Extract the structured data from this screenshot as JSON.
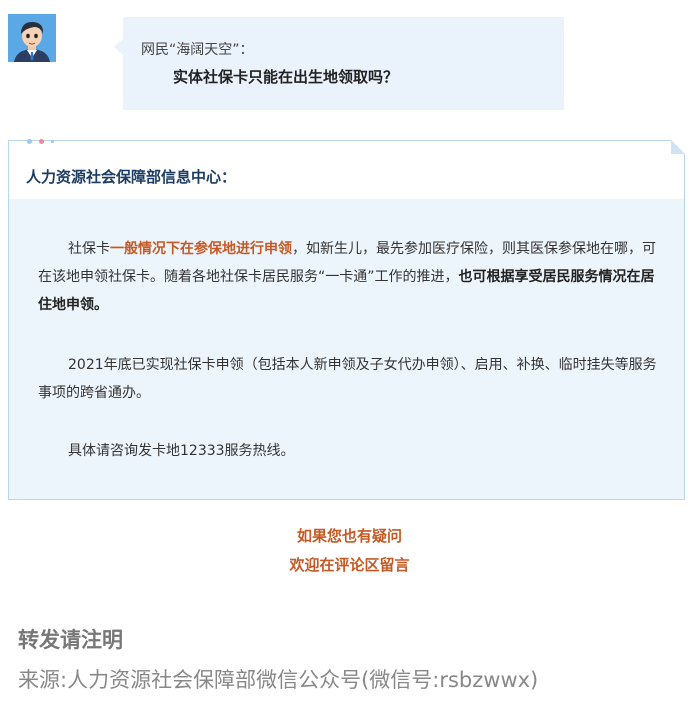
{
  "question": {
    "user": "网民“海阔天空”：",
    "text": "实体社保卡只能在出生地领取吗？"
  },
  "answer": {
    "source": "人力资源社会保障部信息中心：",
    "p1_a": "社保卡",
    "p1_hl": "一般情况下在参保地进行申领",
    "p1_b": "，如新生儿，最先参加医疗保险，则其医保参保地在哪，可在该地申领社保卡。随着各地社保卡居民服务“一卡通”工作的推进，",
    "p1_bold": "也可根据享受居民服务情况在居住地申领。",
    "p2": "2021年底已实现社保卡申领（包括本人新申领及子女代办申领）、启用、补换、临时挂失等服务事项的跨省通办。",
    "p3": "具体请咨询发卡地12333服务热线。"
  },
  "cta": {
    "line1": "如果您也有疑问",
    "line2": "欢迎在评论区留言"
  },
  "repost": {
    "title": "转发请注明",
    "source": "来源:人力资源社会保障部微信公众号(微信号:rsbzwwx)"
  }
}
